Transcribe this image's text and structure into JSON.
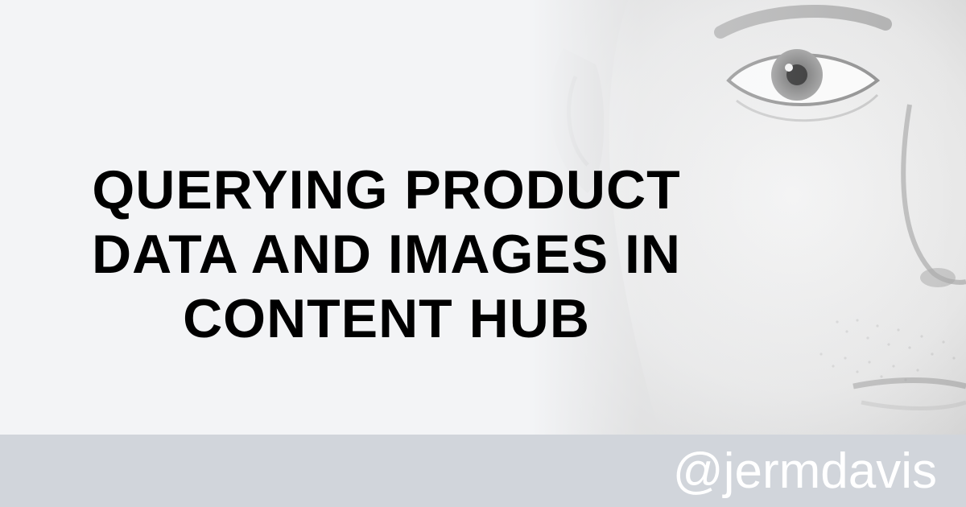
{
  "hero": {
    "title_lines": [
      "QUERYING PRODUCT",
      "DATA AND IMAGES IN",
      "CONTENT HUB"
    ]
  },
  "footer": {
    "handle": "@jermdavis"
  },
  "colors": {
    "background": "#f3f4f6",
    "footer_band": "#d1d5db",
    "title_text": "#000000",
    "handle_text": "#ffffff"
  },
  "images": {
    "portrait": "grayscale-face-closeup"
  }
}
